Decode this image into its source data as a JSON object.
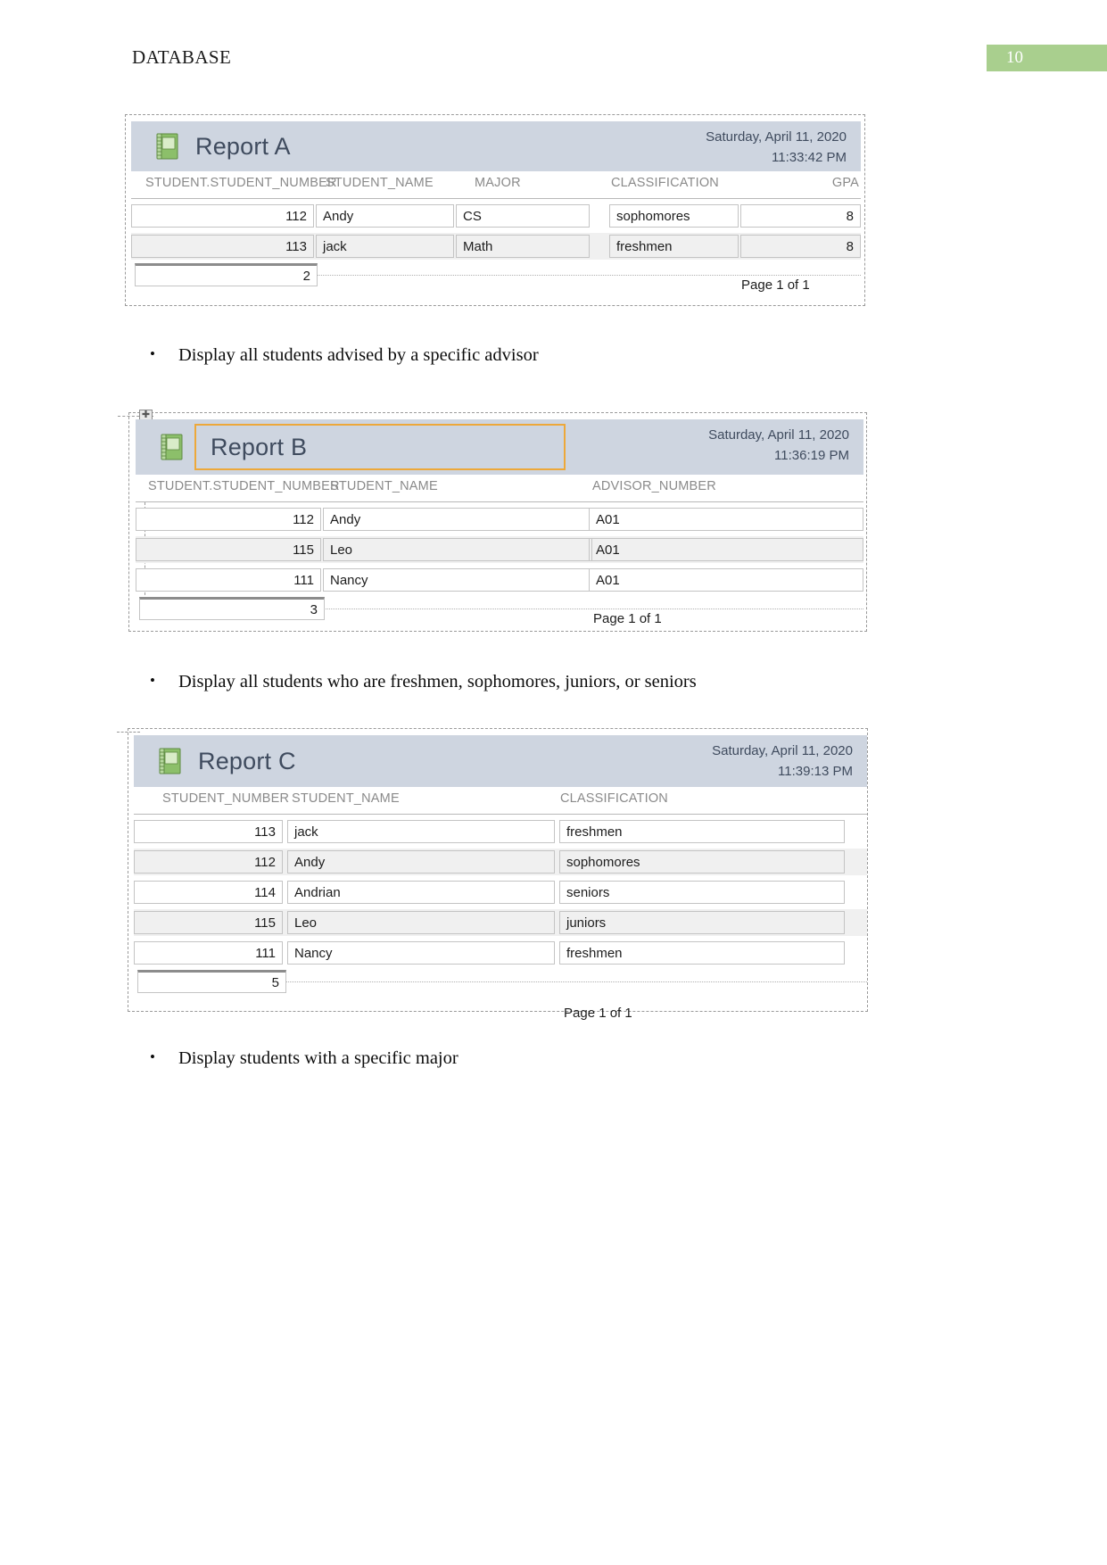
{
  "header": {
    "title": "DATABASE",
    "page_number": "10"
  },
  "bullets": [
    {
      "marker": "•",
      "text": "Display all students advised by a specific advisor"
    },
    {
      "marker": "•",
      "text": "Display all students who are freshmen, sophomores, juniors, or seniors"
    },
    {
      "marker": "•",
      "text": "Display students with a specific major"
    }
  ],
  "reports": [
    {
      "title": "Report A",
      "icon": "report-notebook-icon",
      "date": "Saturday, April 11, 2020",
      "time": "11:33:42 PM",
      "columns": [
        "STUDENT.STUDENT_NUMBER",
        "STUDENT_NAME",
        "MAJOR",
        "CLASSIFICATION",
        "GPA"
      ],
      "rows": [
        {
          "student_number": "112",
          "student_name": "Andy",
          "major": "CS",
          "classification": "sophomores",
          "gpa": "8"
        },
        {
          "student_number": "113",
          "student_name": "jack",
          "major": "Math",
          "classification": "freshmen",
          "gpa": "8"
        }
      ],
      "count": "2",
      "page_of": "Page 1 of 1",
      "title_selected": false
    },
    {
      "title": "Report B",
      "icon": "report-notebook-icon",
      "date": "Saturday, April 11, 2020",
      "time": "11:36:19 PM",
      "columns": [
        "STUDENT.STUDENT_NUMBER",
        "STUDENT_NAME",
        "ADVISOR_NUMBER"
      ],
      "rows": [
        {
          "student_number": "112",
          "student_name": "Andy",
          "advisor_number": "A01"
        },
        {
          "student_number": "115",
          "student_name": "Leo",
          "advisor_number": "A01"
        },
        {
          "student_number": "111",
          "student_name": "Nancy",
          "advisor_number": "A01"
        }
      ],
      "count": "3",
      "page_of": "Page 1 of 1",
      "title_selected": true
    },
    {
      "title": "Report C",
      "icon": "report-notebook-icon",
      "date": "Saturday, April 11, 2020",
      "time": "11:39:13 PM",
      "columns": [
        "STUDENT_NUMBER",
        "STUDENT_NAME",
        "CLASSIFICATION"
      ],
      "rows": [
        {
          "student_number": "113",
          "student_name": "jack",
          "classification": "freshmen"
        },
        {
          "student_number": "112",
          "student_name": "Andy",
          "classification": "sophomores"
        },
        {
          "student_number": "114",
          "student_name": "Andrian",
          "classification": "seniors"
        },
        {
          "student_number": "115",
          "student_name": "Leo",
          "classification": "juniors"
        },
        {
          "student_number": "111",
          "student_name": "Nancy",
          "classification": "freshmen"
        }
      ],
      "count": "5",
      "page_of": "Page 1 of 1",
      "title_selected": false
    }
  ],
  "colors": {
    "badge_green": "#a9cf8e",
    "report_header_blue": "#ced5e0",
    "selection_orange": "#eda83a"
  }
}
